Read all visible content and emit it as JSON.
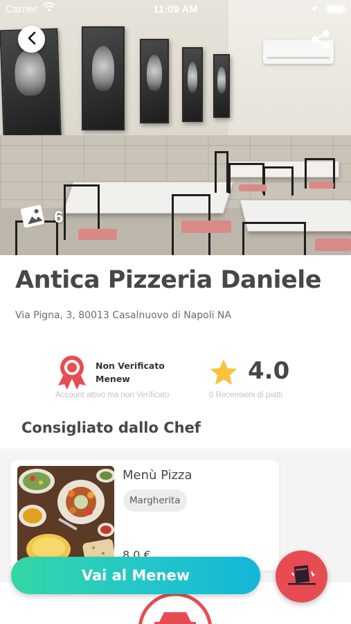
{
  "status_bar": {
    "carrier": "Carrier",
    "time": "11:09 AM"
  },
  "hero": {
    "photo_count": "6",
    "back_icon": "chevron-left-icon",
    "share_icon": "share-icon",
    "gallery_icon": "image-gallery-icon"
  },
  "restaurant": {
    "name": "Antica Pizzeria Daniele",
    "address": "Via Pigna, 3, 80013 Casalnuovo di Napoli NA"
  },
  "verification": {
    "icon": "award-ribbon-icon",
    "label_line1": "Non Verificato",
    "label_line2": "Menew",
    "subtitle": "Account attivo ma non Verificato"
  },
  "rating": {
    "icon": "star-icon",
    "value": "4.0",
    "reviews_text": "0 Recensioni di piatti"
  },
  "chef_section": {
    "title": "Consigliato dallo Chef",
    "card": {
      "dish_name": "Menù Pizza",
      "tag": "Margherita",
      "price": "8,0 €"
    }
  },
  "cta": {
    "label": "Vai al Menew"
  },
  "fab": {
    "icon": "menu-card-icon"
  },
  "colors": {
    "accent_red": "#e84c53",
    "cta_start": "#35d6a6",
    "cta_end": "#13b6d8",
    "star": "#f9c23c",
    "title": "#474747"
  }
}
